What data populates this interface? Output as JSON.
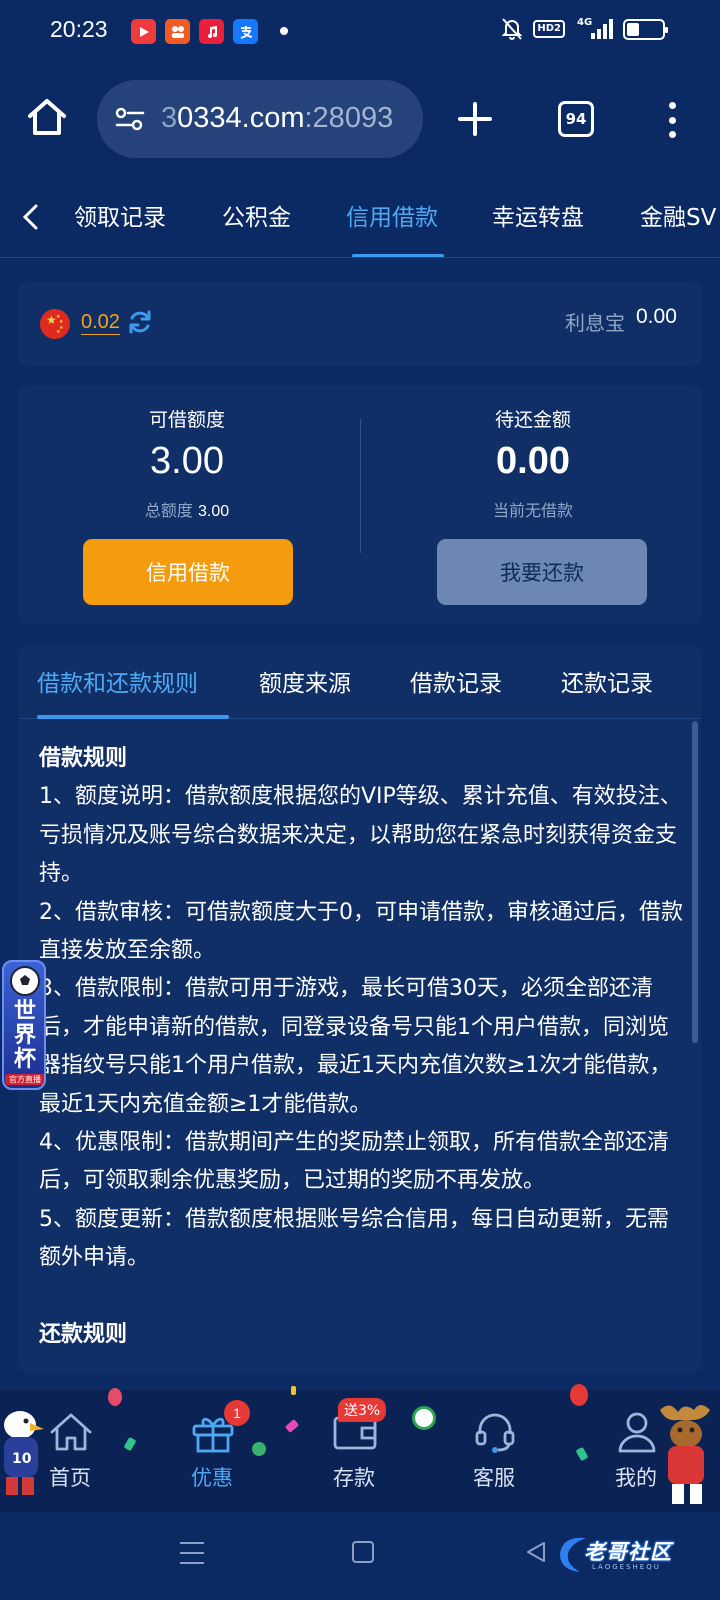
{
  "status_bar": {
    "time": "20:23",
    "network_badge": "HD2",
    "signal_label": "4G",
    "battery_level": 0.35,
    "app_icons": [
      "video-app-icon",
      "media-app-icon",
      "music-app-icon",
      "alipay-app-icon"
    ]
  },
  "browser": {
    "url_faded": "3",
    "url_main": "0334.com",
    "url_port": ":28093",
    "tab_count": "94"
  },
  "category_tabs": {
    "items": [
      "领取记录",
      "公积金",
      "信用借款",
      "幸运转盘",
      "金融SV"
    ],
    "active_index": 2
  },
  "balance": {
    "amount": "0.02",
    "lixibao_label": "利息宝",
    "lixibao_value": "0.00"
  },
  "loan": {
    "available_label": "可借额度",
    "available_value": "3.00",
    "total_label": "总额度",
    "total_value": "3.00",
    "pending_label": "待还金额",
    "pending_value": "0.00",
    "pending_note": "当前无借款",
    "borrow_button": "信用借款",
    "repay_button": "我要还款"
  },
  "rules": {
    "tabs": [
      "借款和还款规则",
      "额度来源",
      "借款记录",
      "还款记录"
    ],
    "active_index": 0,
    "borrow_heading": "借款规则",
    "items": [
      "1、额度说明：借款额度根据您的VIP等级、累计充值、有效投注、亏损情况及账号综合数据来决定，以帮助您在紧急时刻获得资金支持。",
      "2、借款审核：可借款额度大于0，可申请借款，审核通过后，借款直接发放至余额。",
      "3、借款限制：借款可用于游戏，最长可借30天，必须全部还清后，才能申请新的借款，同登录设备号只能1个用户借款，同浏览器指纹号只能1个用户借款，最近1天内充值次数≥1次才能借款，最近1天内充值金额≥1才能借款。",
      "4、优惠限制：借款期间产生的奖励禁止领取，所有借款全部还清后，可领取剩余优惠奖励，已过期的奖励不再发放。",
      "5、额度更新：借款额度根据账号综合信用，每日自动更新，无需额外申请。"
    ],
    "repay_heading": "还款规则"
  },
  "floating_badge": {
    "title": "世界杯",
    "subtitle": "官方直播"
  },
  "bottom_nav": {
    "items": [
      {
        "label": "首页",
        "icon": "home-icon"
      },
      {
        "label": "优惠",
        "icon": "gift-icon",
        "badge": "1"
      },
      {
        "label": "存款",
        "icon": "wallet-icon",
        "badge": "送3%"
      },
      {
        "label": "客服",
        "icon": "headset-icon"
      },
      {
        "label": "我的",
        "icon": "user-icon"
      }
    ],
    "active_index": 1
  },
  "watermark": {
    "title": "老哥社区",
    "subtitle": "LAOGESHEQU"
  },
  "colors": {
    "background": "#0b2a63",
    "card": "#102f66",
    "accent_blue": "#4fa9f2",
    "accent_orange": "#f49c0d",
    "repay_button": "#6d86b4",
    "muted_text": "#8fa6c8"
  }
}
